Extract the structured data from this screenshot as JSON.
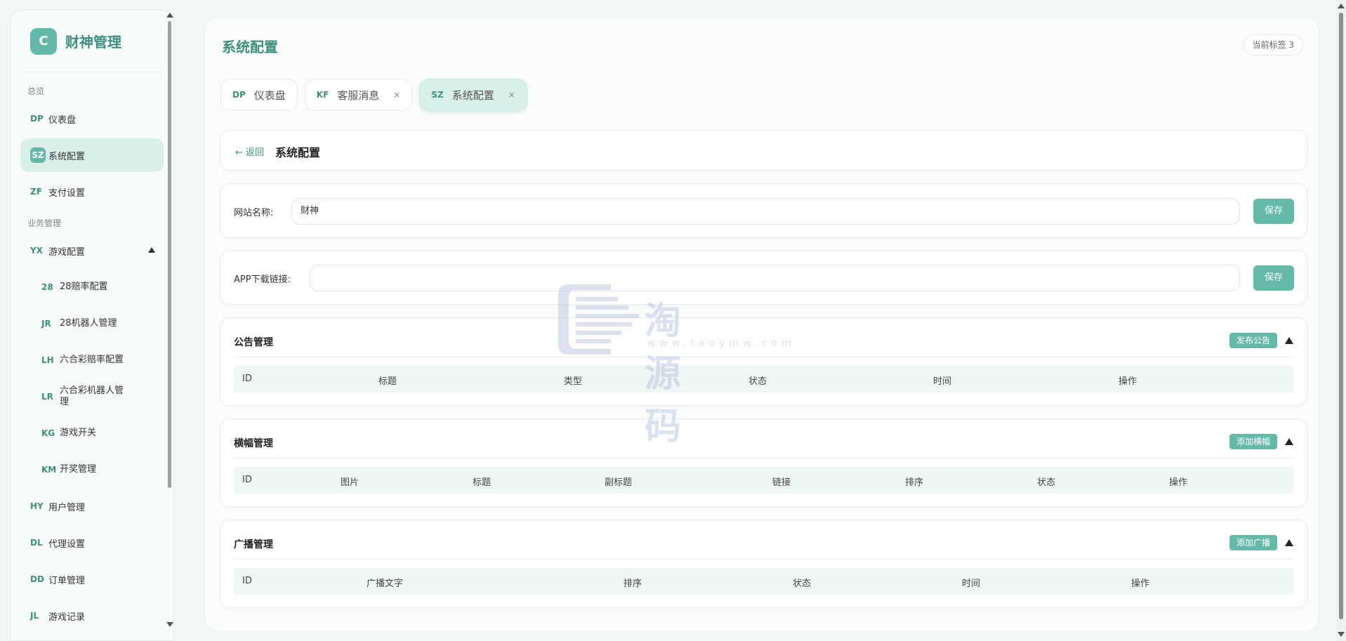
{
  "brand": {
    "logo": "C",
    "name": "财神管理"
  },
  "sidebar": {
    "group_overview": "总览",
    "group_business": "业务管理",
    "items": [
      {
        "code": "DP",
        "label": "仪表盘"
      },
      {
        "code": "SZ",
        "label": "系统配置"
      },
      {
        "code": "ZF",
        "label": "支付设置"
      },
      {
        "code": "YX",
        "label": "游戏配置"
      },
      {
        "code": "HY",
        "label": "用户管理"
      },
      {
        "code": "DL",
        "label": "代理设置"
      },
      {
        "code": "DD",
        "label": "订单管理"
      },
      {
        "code": "JL",
        "label": "游戏记录"
      }
    ],
    "sub_items": [
      {
        "code": "28",
        "label": "28赔率配置"
      },
      {
        "code": "JR",
        "label": "28机器人管理"
      },
      {
        "code": "LH",
        "label": "六合彩赔率配置"
      },
      {
        "code": "LR",
        "label": "六合彩机器人管理"
      },
      {
        "code": "KG",
        "label": "游戏开关"
      },
      {
        "code": "KM",
        "label": "开奖管理"
      }
    ]
  },
  "header": {
    "title": "系统配置",
    "tag_count": "当前标签 3"
  },
  "tabs": [
    {
      "code": "DP",
      "label": "仪表盘"
    },
    {
      "code": "KF",
      "label": "客服消息",
      "close": "×"
    },
    {
      "code": "SZ",
      "label": "系统配置",
      "close": "×"
    }
  ],
  "breadcrumb": {
    "back": "← 返回",
    "title": "系统配置"
  },
  "site_name": {
    "label": "网站名称:",
    "value": "财神",
    "save": "保存"
  },
  "app_link": {
    "label": "APP下载链接:",
    "value": "",
    "save": "保存"
  },
  "notice": {
    "title": "公告管理",
    "button": "发布公告",
    "columns": [
      "ID",
      "标题",
      "类型",
      "状态",
      "时间",
      "操作"
    ]
  },
  "banner": {
    "title": "横幅管理",
    "button": "添加横幅",
    "columns": [
      "ID",
      "图片",
      "标题",
      "副标题",
      "链接",
      "排序",
      "状态",
      "操作"
    ]
  },
  "broadcast": {
    "title": "广播管理",
    "button": "添加广播",
    "columns": [
      "ID",
      "广播文字",
      "排序",
      "状态",
      "时间",
      "操作"
    ]
  },
  "watermark": {
    "text": "淘源码",
    "url": "www.taoymw.com"
  },
  "colors": {
    "accent": "#64b9aa",
    "accent_dark": "#3f8f7e",
    "active_bg": "#d9efe9"
  }
}
